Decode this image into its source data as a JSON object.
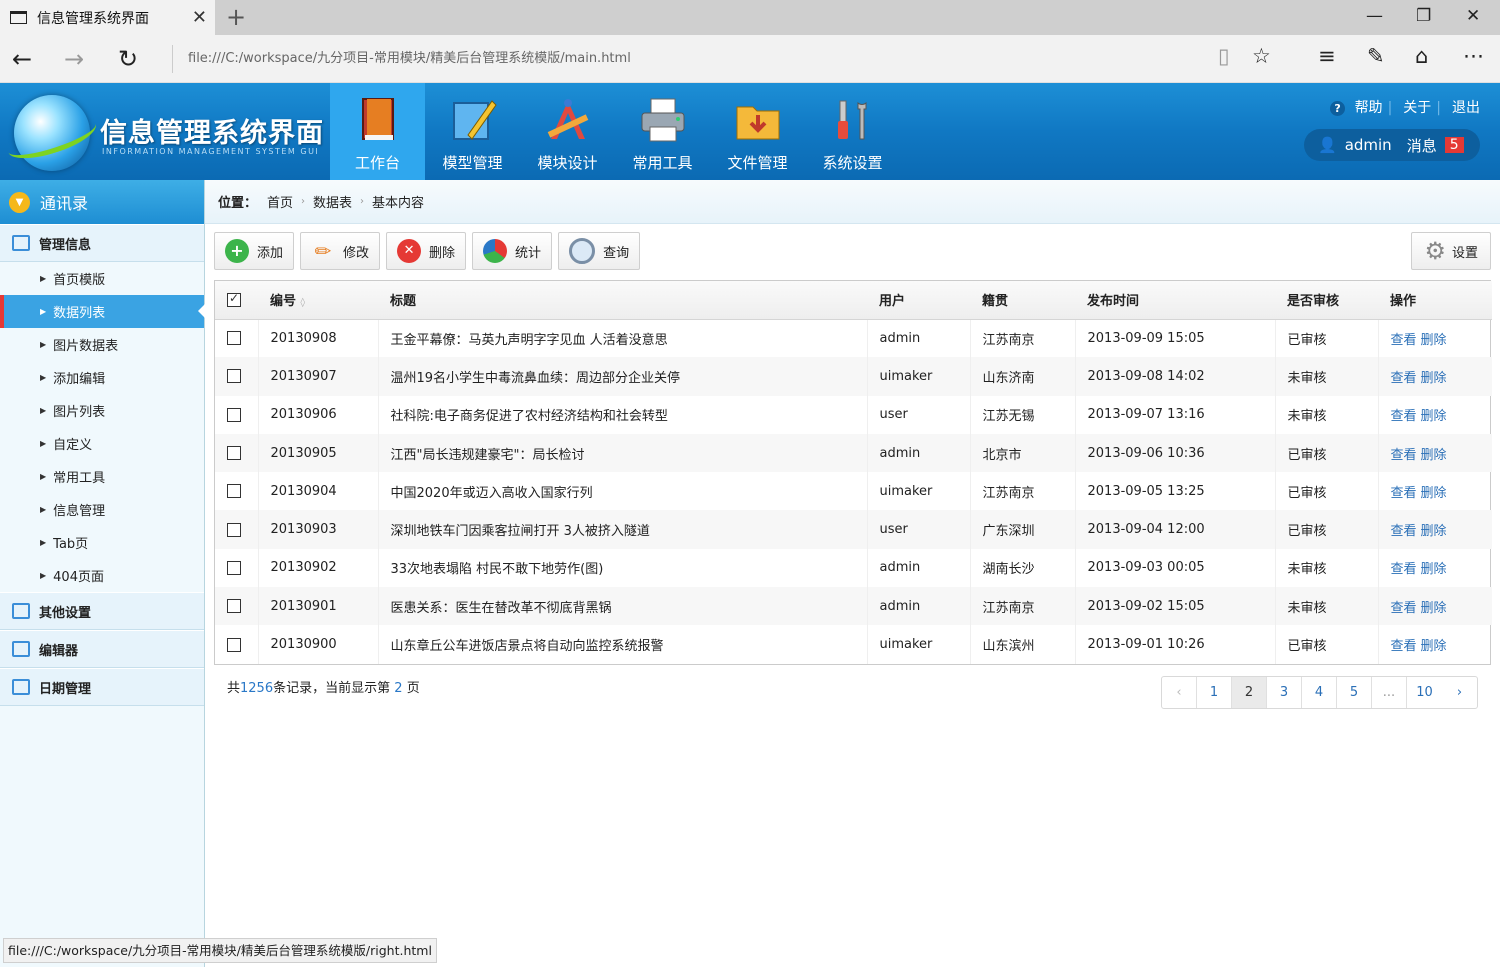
{
  "browser": {
    "tab_title": "信息管理系统界面",
    "url": "file:///C:/workspace/九分项目-常用模块/精美后台管理系统模版/main.html",
    "status_url": "file:///C:/workspace/九分项目-常用模块/精美后台管理系统模版/right.html"
  },
  "header": {
    "title": "信息管理系统界面",
    "subtitle": "INFORMATION MANAGEMENT SYSTEM GUI",
    "nav": [
      {
        "label": "工作台"
      },
      {
        "label": "模型管理"
      },
      {
        "label": "模块设计"
      },
      {
        "label": "常用工具"
      },
      {
        "label": "文件管理"
      },
      {
        "label": "系统设置"
      }
    ],
    "links": {
      "help": "帮助",
      "about": "关于",
      "logout": "退出"
    },
    "user": {
      "name": "admin",
      "msg_label": "消息",
      "msg_count": "5"
    }
  },
  "sidebar": {
    "top": "通讯录",
    "sections": [
      {
        "label": "管理信息"
      },
      {
        "label": "其他设置"
      },
      {
        "label": "编辑器"
      },
      {
        "label": "日期管理"
      }
    ],
    "items": [
      {
        "label": "首页模版"
      },
      {
        "label": "数据列表"
      },
      {
        "label": "图片数据表"
      },
      {
        "label": "添加编辑"
      },
      {
        "label": "图片列表"
      },
      {
        "label": "自定义"
      },
      {
        "label": "常用工具"
      },
      {
        "label": "信息管理"
      },
      {
        "label": "Tab页"
      },
      {
        "label": "404页面"
      }
    ]
  },
  "breadcrumb": {
    "position_label": "位置：",
    "items": [
      "首页",
      "数据表",
      "基本内容"
    ]
  },
  "toolbar": {
    "add": "添加",
    "edit": "修改",
    "delete": "删除",
    "stats": "统计",
    "query": "查询",
    "settings": "设置"
  },
  "table": {
    "headers": [
      "编号",
      "标题",
      "用户",
      "籍贯",
      "发布时间",
      "是否审核",
      "操作"
    ],
    "view_label": "查看",
    "delete_label": "删除",
    "rows": [
      {
        "id": "20130908",
        "title": "王金平幕僚：马英九声明字字见血 人活着没意思",
        "user": "admin",
        "place": "江苏南京",
        "time": "2013-09-09 15:05",
        "status": "已审核"
      },
      {
        "id": "20130907",
        "title": "温州19名小学生中毒流鼻血续：周边部分企业关停",
        "user": "uimaker",
        "place": "山东济南",
        "time": "2013-09-08 14:02",
        "status": "未审核"
      },
      {
        "id": "20130906",
        "title": "社科院:电子商务促进了农村经济结构和社会转型",
        "user": "user",
        "place": "江苏无锡",
        "time": "2013-09-07 13:16",
        "status": "未审核"
      },
      {
        "id": "20130905",
        "title": "江西\"局长违规建豪宅\"：局长检讨",
        "user": "admin",
        "place": "北京市",
        "time": "2013-09-06 10:36",
        "status": "已审核"
      },
      {
        "id": "20130904",
        "title": "中国2020年或迈入高收入国家行列",
        "user": "uimaker",
        "place": "江苏南京",
        "time": "2013-09-05 13:25",
        "status": "已审核"
      },
      {
        "id": "20130903",
        "title": "深圳地铁车门因乘客拉闸打开 3人被挤入隧道",
        "user": "user",
        "place": "广东深圳",
        "time": "2013-09-04 12:00",
        "status": "已审核"
      },
      {
        "id": "20130902",
        "title": "33次地表塌陷 村民不敢下地劳作(图)",
        "user": "admin",
        "place": "湖南长沙",
        "time": "2013-09-03 00:05",
        "status": "未审核"
      },
      {
        "id": "20130901",
        "title": "医患关系：医生在替改革不彻底背黑锅",
        "user": "admin",
        "place": "江苏南京",
        "time": "2013-09-02 15:05",
        "status": "未审核"
      },
      {
        "id": "20130900",
        "title": "山东章丘公车进饭店景点将自动向监控系统报警",
        "user": "uimaker",
        "place": "山东滨州",
        "time": "2013-09-01 10:26",
        "status": "已审核"
      }
    ]
  },
  "footer": {
    "prefix": "共",
    "total": "1256",
    "mid": "条记录，当前显示第",
    "current": "2",
    "suffix": "页"
  },
  "pager": {
    "pages": [
      "1",
      "2",
      "3",
      "4",
      "5",
      "...",
      "10"
    ],
    "current": "2"
  }
}
